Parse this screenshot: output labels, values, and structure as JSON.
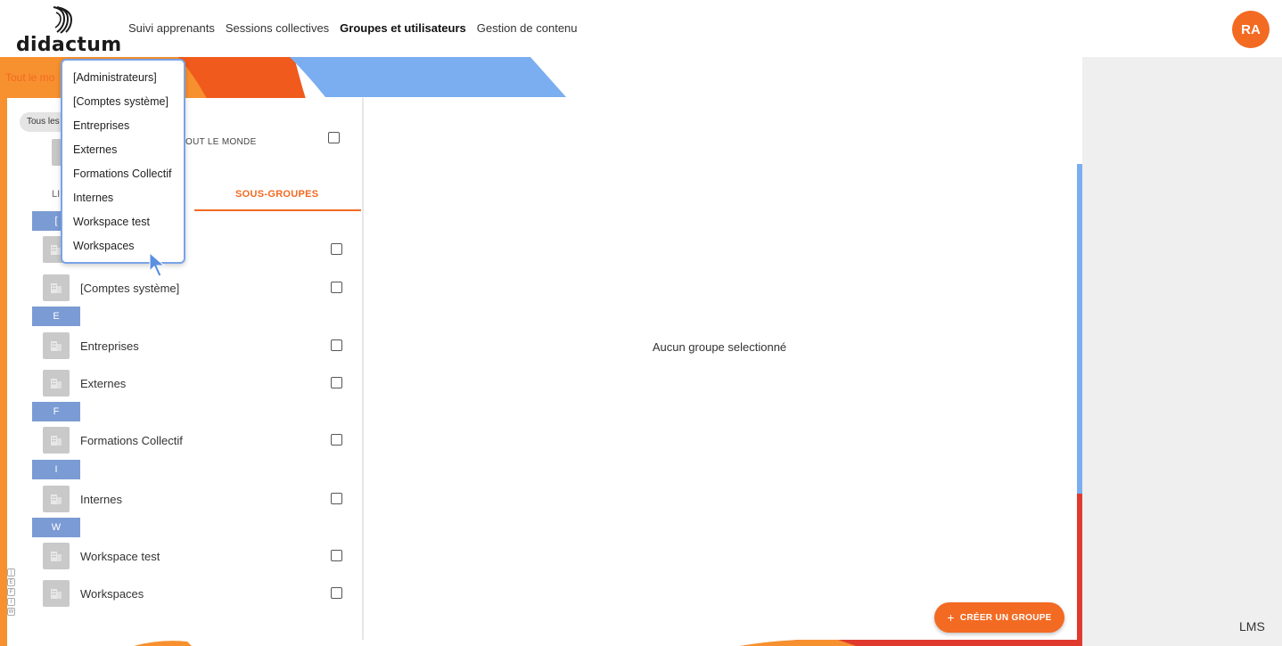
{
  "header": {
    "brand": "didactum",
    "nav": [
      {
        "label": "Suivi apprenants",
        "active": false
      },
      {
        "label": "Sessions collectives",
        "active": false
      },
      {
        "label": "Groupes et utilisateurs",
        "active": true
      },
      {
        "label": "Gestion de contenu",
        "active": false
      }
    ],
    "avatar_initials": "RA"
  },
  "breadcrumb": "Tout le mo",
  "filter_chip": "Tous les",
  "everyone_label": "OUT LE MONDE",
  "tabs": {
    "list": "LI",
    "subgroups": "SOUS-GROUPES"
  },
  "letters": [
    "[",
    "E",
    "F",
    "I",
    "W"
  ],
  "groups": [
    "[Comptes système]",
    "Entreprises",
    "Externes",
    "Formations Collectif",
    "Internes",
    "Workspace test",
    "Workspaces"
  ],
  "dropdown": {
    "items": [
      "[Administrateurs]",
      "[Comptes système]",
      "Entreprises",
      "Externes",
      "Formations Collectif",
      "Internes",
      "Workspace test",
      "Workspaces"
    ]
  },
  "alpha_index": [
    "[",
    "E",
    "F",
    "I",
    "W"
  ],
  "detail": {
    "empty_message": "Aucun groupe selectionné",
    "create_button": "CRÉER UN GROUPE",
    "create_icon": "+"
  },
  "footer_mark": "LMS",
  "colors": {
    "accent": "#f36a22",
    "blue": "#7b9bd4",
    "light_blue": "#7aaef0",
    "red": "#e03a2e"
  }
}
